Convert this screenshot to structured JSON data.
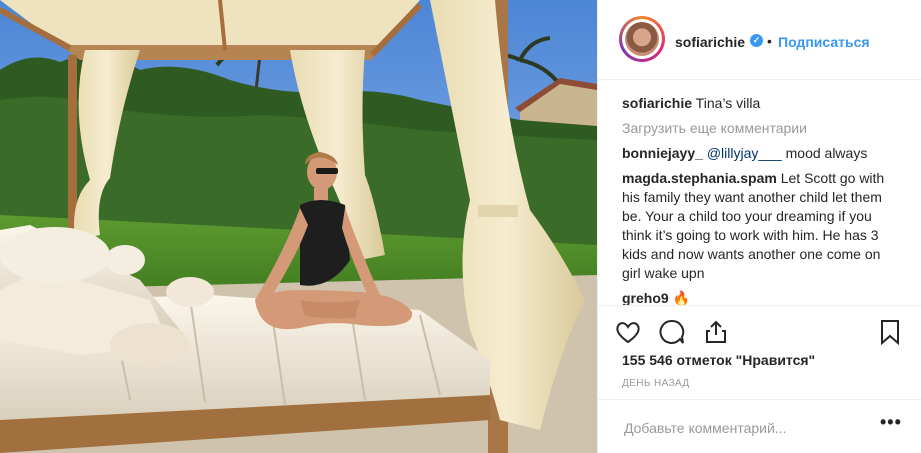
{
  "post": {
    "username": "sofiarichie",
    "follow_label": "Подписаться",
    "dot": "•",
    "verified_mark": "✓"
  },
  "comments": [
    {
      "user": "sofiarichie",
      "text": "Tina’s villa"
    },
    {
      "user": "bonniejayy_",
      "mention": "@lillyjay___",
      "text": " mood always"
    },
    {
      "user": "magda.stephania.spam",
      "text": "Let Scott go with his family they want another child let them be. Your a child too your dreaming if you think it’s going to work with him. He has 3 kids and now wants another one come on girl wake upn"
    },
    {
      "user": "greho9",
      "text": "🔥"
    }
  ],
  "load_more_label": "Загрузить еще комментарии",
  "likes_label": "155 546 отметок \"Нравится\"",
  "time_label": "ДЕНЬ НАЗАД",
  "add_comment_placeholder": "Добавьте комментарий...",
  "options_label": "•••",
  "icons": [
    "heart-icon",
    "comment-icon",
    "share-icon",
    "bookmark-icon"
  ],
  "colors": {
    "link": "#3897f0",
    "muted": "#999999",
    "text": "#262626",
    "mention": "#003569"
  }
}
